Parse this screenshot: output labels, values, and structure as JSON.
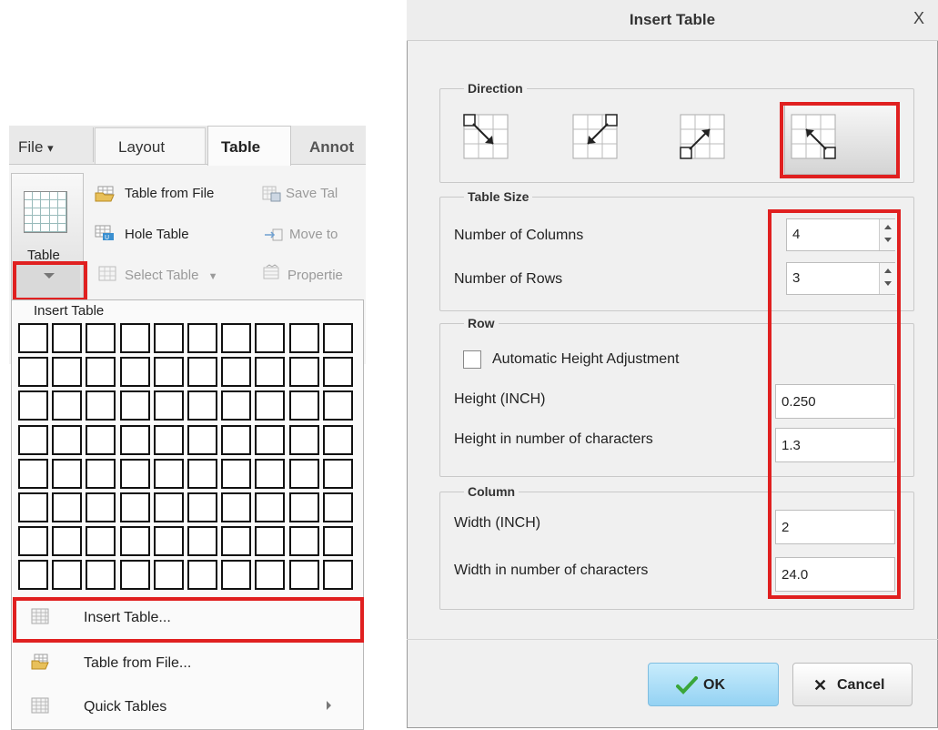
{
  "ribbon": {
    "tabs": [
      "File",
      "Layout",
      "Table",
      "Annot"
    ],
    "file_arrow": "▾",
    "big_button_label": "Table",
    "commands": {
      "table_from_file": "Table from File",
      "save_table": "Save Tal",
      "hole_table": "Hole Table",
      "move_to": "Move to",
      "select_table": "Select Table",
      "properties": "Propertie"
    }
  },
  "dropdown": {
    "header": "Insert Table",
    "grid": {
      "columns": 10,
      "rows": 8
    },
    "items": [
      "Insert Table...",
      "Table from File...",
      "Quick Tables"
    ]
  },
  "dialog": {
    "title": "Insert Table",
    "close_glyph": "X",
    "sections": {
      "direction": "Direction",
      "table_size": "Table Size",
      "row": "Row",
      "column": "Column"
    },
    "table_size": {
      "columns_label": "Number of Columns",
      "columns_value": "4",
      "rows_label": "Number of Rows",
      "rows_value": "3"
    },
    "row": {
      "auto_height_label": "Automatic Height Adjustment",
      "auto_height_checked": false,
      "height_label": "Height (INCH)",
      "height_value": "0.250",
      "height_chars_label": "Height in number of characters",
      "height_chars_value": "1.3"
    },
    "column": {
      "width_label": "Width (INCH)",
      "width_value": "2",
      "width_chars_label": "Width in number of characters",
      "width_chars_value": "24.0"
    },
    "buttons": {
      "ok": "OK",
      "cancel": "Cancel"
    },
    "selected_direction": 4
  },
  "colors": {
    "highlight": "#e02020",
    "ok_button": "#a8dcf7",
    "check_green": "#3aa63a"
  }
}
